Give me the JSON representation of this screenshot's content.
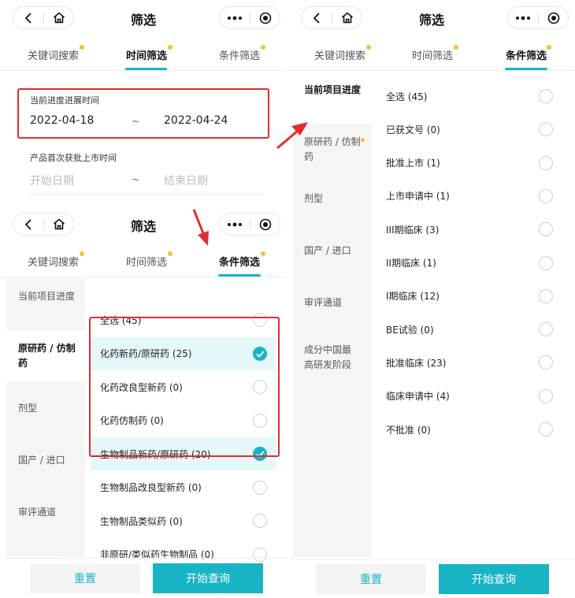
{
  "app": {
    "title": "筛选"
  },
  "tabs": [
    {
      "label": "关键词搜索",
      "dot": true
    },
    {
      "label": "时间筛选",
      "dot": true
    },
    {
      "label": "条件筛选",
      "dot": true
    }
  ],
  "time_filter": {
    "progress": {
      "label": "当前进度进展时间",
      "start": "2022-04-18",
      "end": "2022-04-24",
      "separator": "~"
    },
    "approval": {
      "label": "产品首次获批上市时间",
      "start_placeholder": "开始日期",
      "end_placeholder": "结束日期",
      "separator": "~"
    }
  },
  "categories": [
    {
      "label": "当前项目进度"
    },
    {
      "label": "原研药 / 仿制药",
      "dot": true
    },
    {
      "label": "剂型"
    },
    {
      "label": "国产 / 进口"
    },
    {
      "label": "审评通道"
    },
    {
      "label": "成分中国最高研发阶段"
    }
  ],
  "drug_type_options": [
    {
      "label": "全选 (45)",
      "selected": false
    },
    {
      "label": "化药新药/原研药 (25)",
      "selected": true
    },
    {
      "label": "化药改良型新药 (0)",
      "selected": false
    },
    {
      "label": "化药仿制药 (0)",
      "selected": false
    },
    {
      "label": "生物制品新药/原研药 (20)",
      "selected": true
    },
    {
      "label": "生物制品改良型新药 (0)",
      "selected": false
    },
    {
      "label": "生物制品类似药 (0)",
      "selected": false
    },
    {
      "label": "非原研/类似药生物制品 (0)",
      "selected": false
    }
  ],
  "progress_options": [
    {
      "label": "全选 (45)",
      "selected": false
    },
    {
      "label": "已获文号 (0)",
      "selected": false
    },
    {
      "label": "批准上市 (1)",
      "selected": false
    },
    {
      "label": "上市申请中 (1)",
      "selected": false
    },
    {
      "label": "III期临床 (3)",
      "selected": false
    },
    {
      "label": "II期临床 (1)",
      "selected": false
    },
    {
      "label": "I期临床 (12)",
      "selected": false
    },
    {
      "label": "BE试验 (0)",
      "selected": false
    },
    {
      "label": "批准临床 (23)",
      "selected": false
    },
    {
      "label": "临床申请中 (4)",
      "selected": false
    },
    {
      "label": "不批准 (0)",
      "selected": false
    }
  ],
  "buttons": {
    "reset": "重置",
    "search": "开始查询"
  },
  "colors": {
    "accent": "#18b4c6",
    "highlight": "#e22c2c",
    "dot": "#f2c230",
    "selected_row": "#e6f7fa"
  },
  "icons": {
    "back": "chevron-left-icon",
    "home": "home-icon",
    "more": "more-dots-icon",
    "record": "target-icon",
    "check": "check-icon"
  }
}
